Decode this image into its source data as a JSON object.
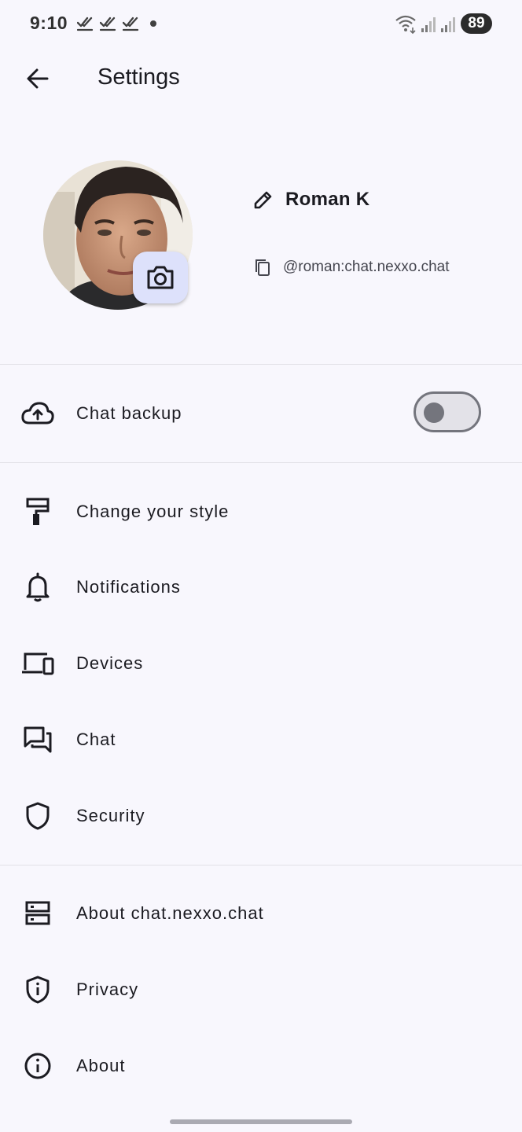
{
  "status_bar": {
    "time": "9:10",
    "battery": "89",
    "icons": [
      "done-all-icon",
      "done-all-icon",
      "done-all-icon",
      "notification-dot-icon",
      "wifi-icon",
      "signal-icon",
      "signal-icon"
    ]
  },
  "app_bar": {
    "title": "Settings",
    "back_icon": "arrow-back-icon"
  },
  "profile": {
    "display_name": "Roman K",
    "user_id": "@roman:chat.nexxo.chat",
    "edit_icon": "pencil-icon",
    "copy_icon": "copy-icon",
    "camera_icon": "camera-icon"
  },
  "chat_backup": {
    "label": "Chat backup",
    "icon": "cloud-upload-icon",
    "enabled": false
  },
  "menu_groups": [
    [
      {
        "label": "Change your style",
        "icon": "paint-roller-icon"
      },
      {
        "label": "Notifications",
        "icon": "bell-icon"
      },
      {
        "label": "Devices",
        "icon": "devices-icon"
      },
      {
        "label": "Chat",
        "icon": "forum-icon"
      },
      {
        "label": "Security",
        "icon": "shield-icon"
      }
    ],
    [
      {
        "label": "About chat.nexxo.chat",
        "icon": "dns-icon"
      },
      {
        "label": "Privacy",
        "icon": "privacy-shield-icon"
      },
      {
        "label": "About",
        "icon": "info-icon"
      }
    ]
  ],
  "colors": {
    "background": "#f8f7fd",
    "camera_button": "#dde1fb",
    "divider": "#e3e2e8",
    "text": "#1b1b21"
  }
}
